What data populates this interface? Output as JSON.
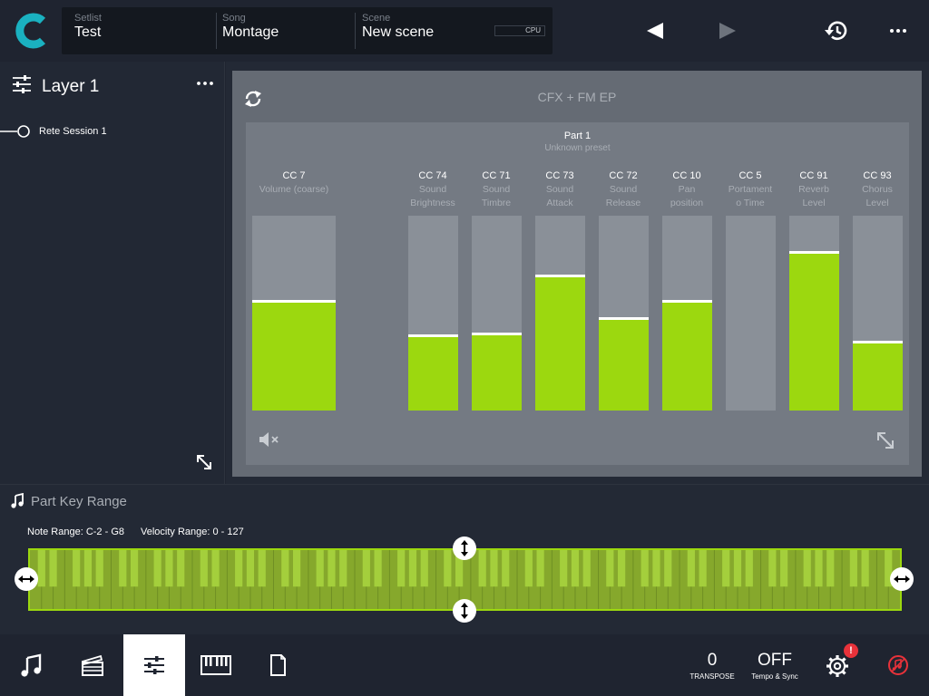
{
  "header": {
    "setlist_label": "Setlist",
    "setlist_value": "Test",
    "song_label": "Song",
    "song_value": "Montage",
    "scene_label": "Scene",
    "scene_value": "New scene",
    "cpu_label": "CPU"
  },
  "layer": {
    "title": "Layer 1",
    "item_label": "Rete Session 1"
  },
  "part": {
    "card_title": "CFX + FM EP",
    "name": "Part 1",
    "preset": "Unknown preset",
    "controls": [
      {
        "cc": "CC 7",
        "desc1": "Volume (coarse)",
        "desc2": "",
        "level": 0.56
      },
      {
        "cc": "CC 74",
        "desc1": "Sound",
        "desc2": "Brightness",
        "level": 0.38
      },
      {
        "cc": "CC 71",
        "desc1": "Sound",
        "desc2": "Timbre",
        "level": 0.39
      },
      {
        "cc": "CC 73",
        "desc1": "Sound",
        "desc2": "Attack",
        "level": 0.69
      },
      {
        "cc": "CC 72",
        "desc1": "Sound",
        "desc2": "Release",
        "level": 0.47
      },
      {
        "cc": "CC 10",
        "desc1": "Pan",
        "desc2": "position",
        "level": 0.56
      },
      {
        "cc": "CC 5",
        "desc1": "Portament",
        "desc2": "o Time",
        "level": 0
      },
      {
        "cc": "CC 91",
        "desc1": "Reverb",
        "desc2": "Level",
        "level": 0.81
      },
      {
        "cc": "CC 93",
        "desc1": "Chorus",
        "desc2": "Level",
        "level": 0.35
      }
    ],
    "fill_color": "#9cd80f"
  },
  "keyrange": {
    "title": "Part Key Range",
    "note_range": "Note Range: C-2 - G8",
    "velocity_range": "Velocity Range: 0 - 127"
  },
  "bottom": {
    "transpose_value": "0",
    "transpose_label": "TRANSPOSE",
    "tempo_value": "OFF",
    "tempo_label": "Tempo & Sync",
    "badge": "!"
  }
}
